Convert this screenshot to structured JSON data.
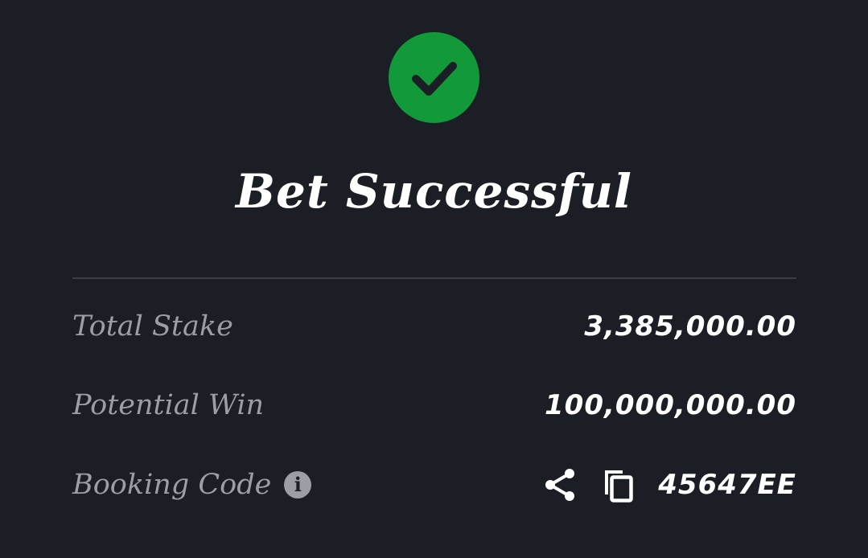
{
  "status": {
    "title": "Bet Successful",
    "icon": "check-circle-icon",
    "color": "#12993a"
  },
  "summary": {
    "total_stake_label": "Total Stake",
    "total_stake_value": "3,385,000.00",
    "potential_win_label": "Potential Win",
    "potential_win_value": "100,000,000.00",
    "booking_code_label": "Booking Code",
    "booking_code_value": "45647EE",
    "info_icon": "info-icon",
    "share_icon": "share-icon",
    "copy_icon": "copy-icon"
  }
}
